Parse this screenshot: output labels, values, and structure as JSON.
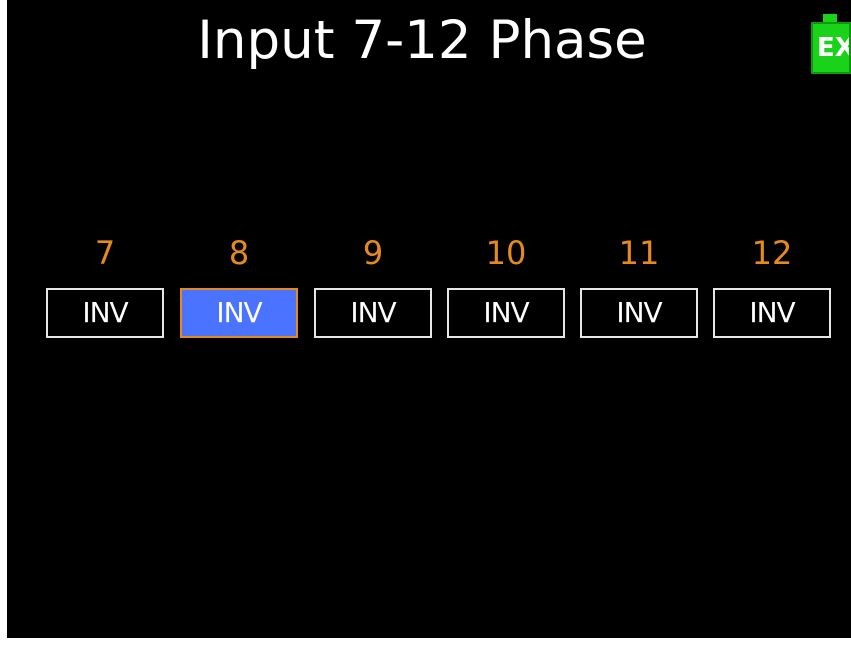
{
  "title": "Input 7-12 Phase",
  "battery": {
    "label": "EX",
    "icon": "battery-external-icon",
    "color": "#19d219"
  },
  "colors": {
    "background": "#000000",
    "channel_number": "#e68a1e",
    "selected_fill": "#4a73ff",
    "selected_border": "#e68a1e",
    "box_border": "#e6e6e6"
  },
  "channels": [
    {
      "number": "7",
      "value": "INV",
      "selected": false
    },
    {
      "number": "8",
      "value": "INV",
      "selected": true
    },
    {
      "number": "9",
      "value": "INV",
      "selected": false
    },
    {
      "number": "10",
      "value": "INV",
      "selected": false
    },
    {
      "number": "11",
      "value": "INV",
      "selected": false
    },
    {
      "number": "12",
      "value": "INV",
      "selected": false
    }
  ]
}
